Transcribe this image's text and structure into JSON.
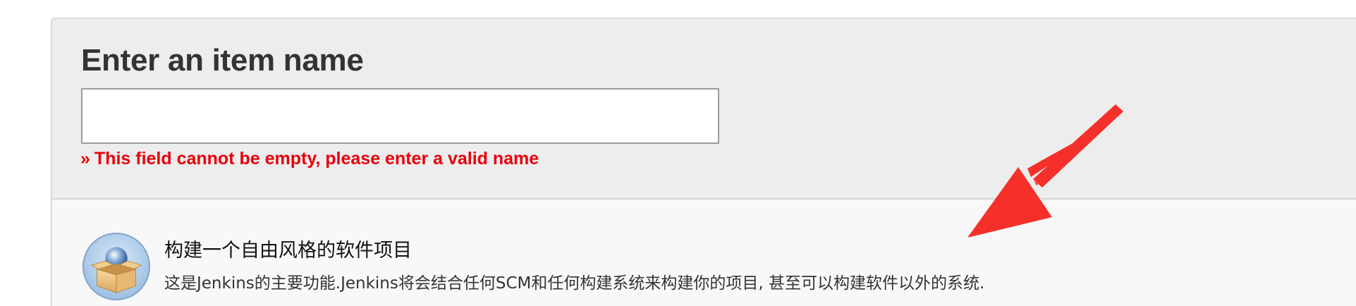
{
  "form": {
    "title": "Enter an item name",
    "name_input_value": "",
    "error_bullet": "»",
    "error_text": "This field cannot be empty, please enter a valid name"
  },
  "item_types": [
    {
      "name": "构建一个自由风格的软件项目",
      "description": "这是Jenkins的主要功能.Jenkins将会结合任何SCM和任何构建系统来构建你的项目, 甚至可以构建软件以外的系统.",
      "icon": "freestyle-project-icon"
    }
  ],
  "colors": {
    "error": "#e8000b",
    "annotation_arrow": "#f5302a",
    "panel_background": "#ededed",
    "item_list_background": "#f8f8f8"
  },
  "annotation": {
    "icon": "red-arrow-icon"
  }
}
